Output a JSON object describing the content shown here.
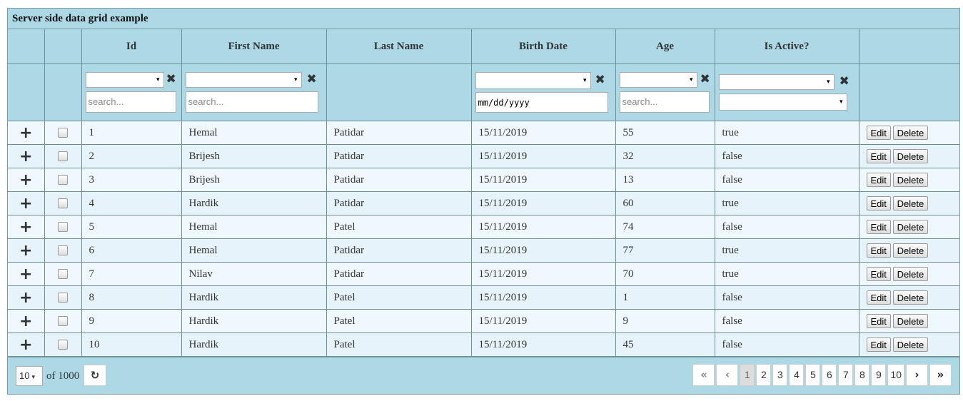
{
  "caption": "Server side data grid example",
  "columns": {
    "id": "Id",
    "first_name": "First Name",
    "last_name": "Last Name",
    "birth_date": "Birth Date",
    "age": "Age",
    "is_active": "Is Active?"
  },
  "filters": {
    "search_placeholder": "search...",
    "date_placeholder": "mm/dd/yyyy",
    "dropdown_arrow": "▾",
    "clear_glyph": "✖"
  },
  "icons": {
    "expand": "+",
    "refresh": "↻"
  },
  "actions": {
    "edit": "Edit",
    "delete": "Delete"
  },
  "rows": [
    {
      "id": "1",
      "first_name": "Hemal",
      "last_name": "Patidar",
      "birth_date": "15/11/2019",
      "age": "55",
      "is_active": "true"
    },
    {
      "id": "2",
      "first_name": "Brijesh",
      "last_name": "Patidar",
      "birth_date": "15/11/2019",
      "age": "32",
      "is_active": "false"
    },
    {
      "id": "3",
      "first_name": "Brijesh",
      "last_name": "Patidar",
      "birth_date": "15/11/2019",
      "age": "13",
      "is_active": "false"
    },
    {
      "id": "4",
      "first_name": "Hardik",
      "last_name": "Patidar",
      "birth_date": "15/11/2019",
      "age": "60",
      "is_active": "true"
    },
    {
      "id": "5",
      "first_name": "Hemal",
      "last_name": "Patel",
      "birth_date": "15/11/2019",
      "age": "74",
      "is_active": "false"
    },
    {
      "id": "6",
      "first_name": "Hemal",
      "last_name": "Patidar",
      "birth_date": "15/11/2019",
      "age": "77",
      "is_active": "true"
    },
    {
      "id": "7",
      "first_name": "Nilav",
      "last_name": "Patidar",
      "birth_date": "15/11/2019",
      "age": "70",
      "is_active": "true"
    },
    {
      "id": "8",
      "first_name": "Hardik",
      "last_name": "Patel",
      "birth_date": "15/11/2019",
      "age": "1",
      "is_active": "false"
    },
    {
      "id": "9",
      "first_name": "Hardik",
      "last_name": "Patel",
      "birth_date": "15/11/2019",
      "age": "9",
      "is_active": "false"
    },
    {
      "id": "10",
      "first_name": "Hardik",
      "last_name": "Patel",
      "birth_date": "15/11/2019",
      "age": "45",
      "is_active": "false"
    }
  ],
  "footer": {
    "page_size": "10",
    "of_total": "of 1000",
    "pager": {
      "first": "«",
      "prev": "‹",
      "next": "›",
      "last": "»",
      "pages": [
        "1",
        "2",
        "3",
        "4",
        "5",
        "6",
        "7",
        "8",
        "9",
        "10"
      ],
      "current": "1"
    }
  }
}
